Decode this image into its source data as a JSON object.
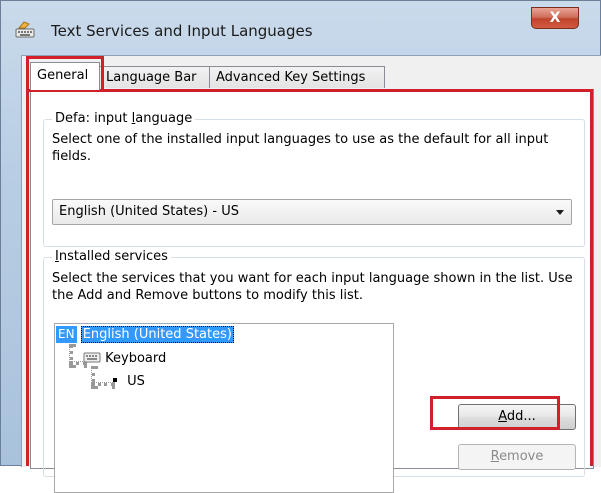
{
  "window": {
    "title": "Text Services and Input Languages",
    "close_glyph": "X"
  },
  "tabs": [
    {
      "label": "General",
      "selected": true
    },
    {
      "label": "Language Bar",
      "selected": false
    },
    {
      "label": "Advanced Key Settings",
      "selected": false
    }
  ],
  "default_input_language": {
    "legend_prefix": "Defa",
    "legend_mid": ": input ",
    "legend_l": "l",
    "legend_rest": "anguage",
    "description": "Select one of the installed input languages to use as the default for all input fields.",
    "selected_value": "English (United States) - US"
  },
  "installed_services": {
    "legend_i": "I",
    "legend_rest": "nstalled services",
    "description": "Select the services that you want for each input language shown in the list. Use the Add and Remove buttons to modify this list.",
    "tree": {
      "language_code": "EN",
      "language_name": "English (United States)",
      "category": "Keyboard",
      "layout": "US"
    },
    "add_button": {
      "a": "A",
      "rest": "dd..."
    },
    "remove_button": {
      "r": "R",
      "rest": "emove"
    }
  },
  "colors": {
    "highlight": "#d0202a",
    "selection": "#3399ff",
    "close_button": "#c0442c"
  }
}
